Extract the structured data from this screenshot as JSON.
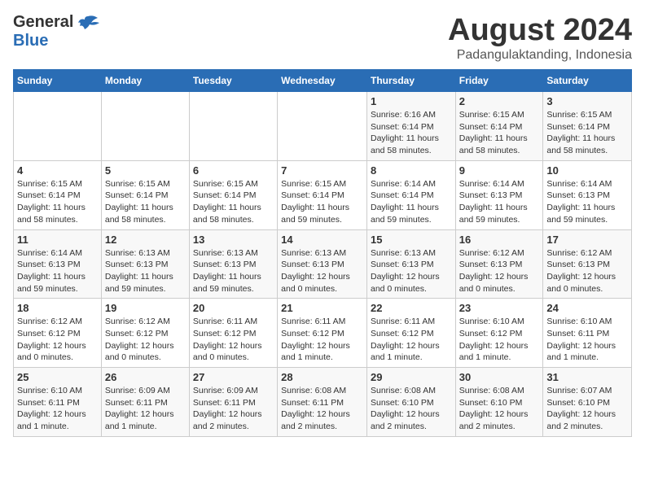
{
  "logo": {
    "general": "General",
    "blue": "Blue"
  },
  "title": "August 2024",
  "subtitle": "Padangulaktanding, Indonesia",
  "days_of_week": [
    "Sunday",
    "Monday",
    "Tuesday",
    "Wednesday",
    "Thursday",
    "Friday",
    "Saturday"
  ],
  "weeks": [
    [
      {
        "day": "",
        "detail": ""
      },
      {
        "day": "",
        "detail": ""
      },
      {
        "day": "",
        "detail": ""
      },
      {
        "day": "",
        "detail": ""
      },
      {
        "day": "1",
        "detail": "Sunrise: 6:16 AM\nSunset: 6:14 PM\nDaylight: 11 hours and 58 minutes."
      },
      {
        "day": "2",
        "detail": "Sunrise: 6:15 AM\nSunset: 6:14 PM\nDaylight: 11 hours and 58 minutes."
      },
      {
        "day": "3",
        "detail": "Sunrise: 6:15 AM\nSunset: 6:14 PM\nDaylight: 11 hours and 58 minutes."
      }
    ],
    [
      {
        "day": "4",
        "detail": "Sunrise: 6:15 AM\nSunset: 6:14 PM\nDaylight: 11 hours and 58 minutes."
      },
      {
        "day": "5",
        "detail": "Sunrise: 6:15 AM\nSunset: 6:14 PM\nDaylight: 11 hours and 58 minutes."
      },
      {
        "day": "6",
        "detail": "Sunrise: 6:15 AM\nSunset: 6:14 PM\nDaylight: 11 hours and 58 minutes."
      },
      {
        "day": "7",
        "detail": "Sunrise: 6:15 AM\nSunset: 6:14 PM\nDaylight: 11 hours and 59 minutes."
      },
      {
        "day": "8",
        "detail": "Sunrise: 6:14 AM\nSunset: 6:14 PM\nDaylight: 11 hours and 59 minutes."
      },
      {
        "day": "9",
        "detail": "Sunrise: 6:14 AM\nSunset: 6:13 PM\nDaylight: 11 hours and 59 minutes."
      },
      {
        "day": "10",
        "detail": "Sunrise: 6:14 AM\nSunset: 6:13 PM\nDaylight: 11 hours and 59 minutes."
      }
    ],
    [
      {
        "day": "11",
        "detail": "Sunrise: 6:14 AM\nSunset: 6:13 PM\nDaylight: 11 hours and 59 minutes."
      },
      {
        "day": "12",
        "detail": "Sunrise: 6:13 AM\nSunset: 6:13 PM\nDaylight: 11 hours and 59 minutes."
      },
      {
        "day": "13",
        "detail": "Sunrise: 6:13 AM\nSunset: 6:13 PM\nDaylight: 11 hours and 59 minutes."
      },
      {
        "day": "14",
        "detail": "Sunrise: 6:13 AM\nSunset: 6:13 PM\nDaylight: 12 hours and 0 minutes."
      },
      {
        "day": "15",
        "detail": "Sunrise: 6:13 AM\nSunset: 6:13 PM\nDaylight: 12 hours and 0 minutes."
      },
      {
        "day": "16",
        "detail": "Sunrise: 6:12 AM\nSunset: 6:13 PM\nDaylight: 12 hours and 0 minutes."
      },
      {
        "day": "17",
        "detail": "Sunrise: 6:12 AM\nSunset: 6:13 PM\nDaylight: 12 hours and 0 minutes."
      }
    ],
    [
      {
        "day": "18",
        "detail": "Sunrise: 6:12 AM\nSunset: 6:12 PM\nDaylight: 12 hours and 0 minutes."
      },
      {
        "day": "19",
        "detail": "Sunrise: 6:12 AM\nSunset: 6:12 PM\nDaylight: 12 hours and 0 minutes."
      },
      {
        "day": "20",
        "detail": "Sunrise: 6:11 AM\nSunset: 6:12 PM\nDaylight: 12 hours and 0 minutes."
      },
      {
        "day": "21",
        "detail": "Sunrise: 6:11 AM\nSunset: 6:12 PM\nDaylight: 12 hours and 1 minute."
      },
      {
        "day": "22",
        "detail": "Sunrise: 6:11 AM\nSunset: 6:12 PM\nDaylight: 12 hours and 1 minute."
      },
      {
        "day": "23",
        "detail": "Sunrise: 6:10 AM\nSunset: 6:12 PM\nDaylight: 12 hours and 1 minute."
      },
      {
        "day": "24",
        "detail": "Sunrise: 6:10 AM\nSunset: 6:11 PM\nDaylight: 12 hours and 1 minute."
      }
    ],
    [
      {
        "day": "25",
        "detail": "Sunrise: 6:10 AM\nSunset: 6:11 PM\nDaylight: 12 hours and 1 minute."
      },
      {
        "day": "26",
        "detail": "Sunrise: 6:09 AM\nSunset: 6:11 PM\nDaylight: 12 hours and 1 minute."
      },
      {
        "day": "27",
        "detail": "Sunrise: 6:09 AM\nSunset: 6:11 PM\nDaylight: 12 hours and 2 minutes."
      },
      {
        "day": "28",
        "detail": "Sunrise: 6:08 AM\nSunset: 6:11 PM\nDaylight: 12 hours and 2 minutes."
      },
      {
        "day": "29",
        "detail": "Sunrise: 6:08 AM\nSunset: 6:10 PM\nDaylight: 12 hours and 2 minutes."
      },
      {
        "day": "30",
        "detail": "Sunrise: 6:08 AM\nSunset: 6:10 PM\nDaylight: 12 hours and 2 minutes."
      },
      {
        "day": "31",
        "detail": "Sunrise: 6:07 AM\nSunset: 6:10 PM\nDaylight: 12 hours and 2 minutes."
      }
    ]
  ]
}
